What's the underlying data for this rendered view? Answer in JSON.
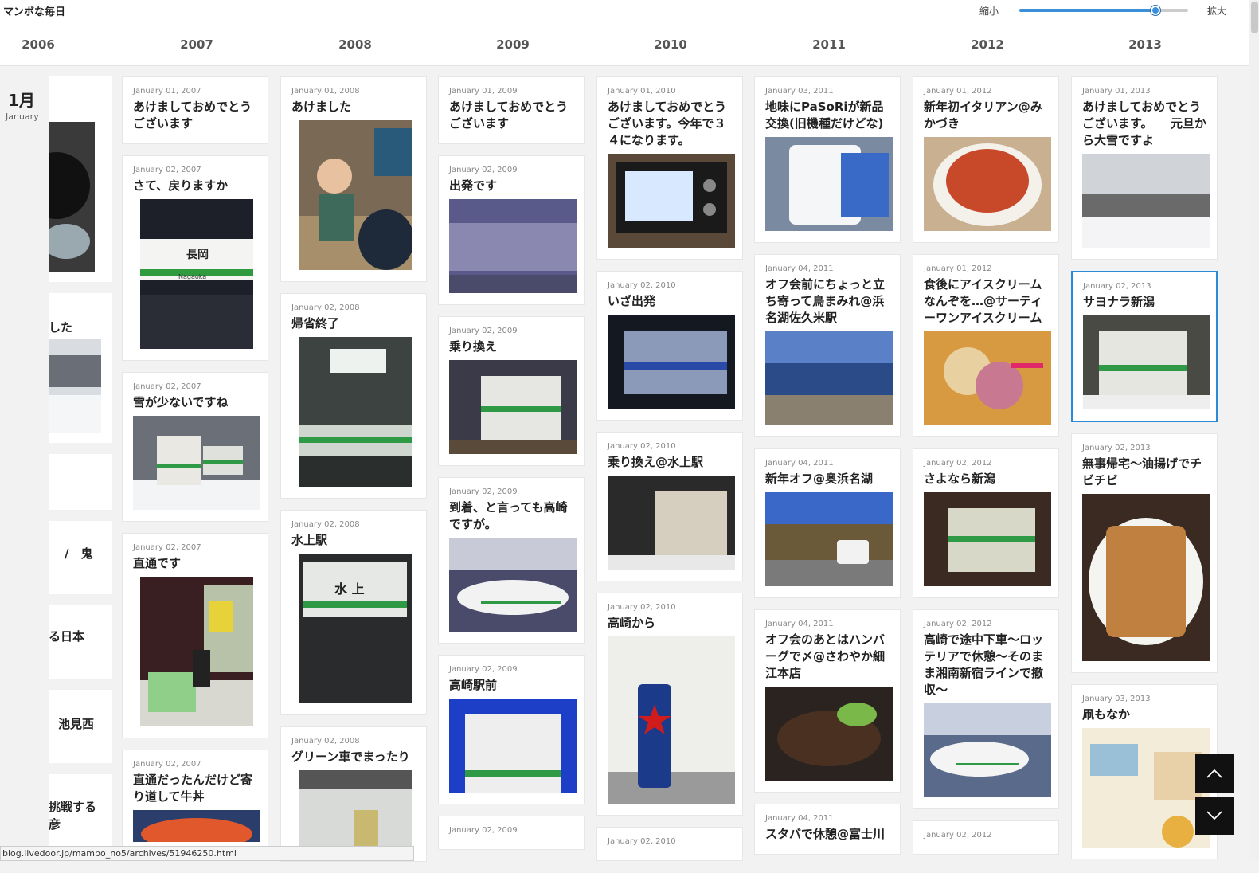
{
  "header": {
    "site_title": "マンボな毎日",
    "zoom_out_label": "縮小",
    "zoom_in_label": "拡大",
    "zoom_level": 0.8
  },
  "years": [
    "2006",
    "2007",
    "2008",
    "2009",
    "2010",
    "2011",
    "2012",
    "2013"
  ],
  "month": {
    "label": "1月",
    "sub": "January"
  },
  "left_fragments": [
    "した",
    "/　鬼",
    "る日本",
    "池見西",
    "挑戦する",
    "彦"
  ],
  "columns": [
    {
      "year": "2007",
      "cards": [
        {
          "date": "January 01, 2007",
          "title": "あけましておめでとうございます"
        },
        {
          "date": "January 02, 2007",
          "title": "さて、戻りますか"
        },
        {
          "date": "January 02, 2007",
          "title": "雪が少ないですね"
        },
        {
          "date": "January 02, 2007",
          "title": "直通です"
        },
        {
          "date": "January 02, 2007",
          "title": "直通だったんだけど寄り道して牛丼"
        }
      ]
    },
    {
      "year": "2008",
      "cards": [
        {
          "date": "January 01, 2008",
          "title": "あけました"
        },
        {
          "date": "January 02, 2008",
          "title": "帰省終了"
        },
        {
          "date": "January 02, 2008",
          "title": "水上駅"
        },
        {
          "date": "January 02, 2008",
          "title": "グリーン車でまったり"
        }
      ]
    },
    {
      "year": "2009",
      "cards": [
        {
          "date": "January 01, 2009",
          "title": "あけましておめでとうございます"
        },
        {
          "date": "January 02, 2009",
          "title": "出発です"
        },
        {
          "date": "January 02, 2009",
          "title": "乗り換え"
        },
        {
          "date": "January 02, 2009",
          "title": "到着、と言っても高崎ですが。"
        },
        {
          "date": "January 02, 2009",
          "title": "高崎駅前"
        },
        {
          "date": "January 02, 2009",
          "title": ""
        }
      ]
    },
    {
      "year": "2010",
      "cards": [
        {
          "date": "January 01, 2010",
          "title": "あけましておめでとうございます。今年で３４になります。"
        },
        {
          "date": "January 02, 2010",
          "title": "いざ出発"
        },
        {
          "date": "January 02, 2010",
          "title": "乗り換え@水上駅"
        },
        {
          "date": "January 02, 2010",
          "title": "高崎から"
        },
        {
          "date": "January 02, 2010",
          "title": ""
        }
      ]
    },
    {
      "year": "2011",
      "cards": [
        {
          "date": "January 03, 2011",
          "title": "地味にPaSoRiが新品交換(旧機種だけどな)"
        },
        {
          "date": "January 04, 2011",
          "title": "オフ会前にちょっと立ち寄って鳥まみれ@浜名湖佐久米駅"
        },
        {
          "date": "January 04, 2011",
          "title": "新年オフ@奥浜名湖"
        },
        {
          "date": "January 04, 2011",
          "title": "オフ会のあとはハンバーグで〆@さわやか細江本店"
        },
        {
          "date": "January 04, 2011",
          "title": "スタバで休憩@富士川"
        }
      ]
    },
    {
      "year": "2012",
      "cards": [
        {
          "date": "January 01, 2012",
          "title": "新年初イタリアン@みかづき"
        },
        {
          "date": "January 01, 2012",
          "title": "食後にアイスクリームなんぞを…@サーティーワンアイスクリーム"
        },
        {
          "date": "January 02, 2012",
          "title": "さよなら新潟"
        },
        {
          "date": "January 02, 2012",
          "title": "高崎で途中下車〜ロッテリアで休憩〜そのまま湘南新宿ラインで撤収〜"
        },
        {
          "date": "January 02, 2012",
          "title": ""
        }
      ]
    },
    {
      "year": "2013",
      "cards": [
        {
          "date": "January 01, 2013",
          "title": "あけましておめでとうございます。　　元旦から大雪ですよ"
        },
        {
          "date": "January 02, 2013",
          "title": "サヨナラ新潟"
        },
        {
          "date": "January 02, 2013",
          "title": "無事帰宅〜油揚げでチビチビ"
        },
        {
          "date": "January 03, 2013",
          "title": "凧もなか"
        }
      ]
    }
  ],
  "status_url": "blog.livedoor.jp/mambo_no5/archives/51946250.html",
  "icons": {
    "up": "chevron-up-icon",
    "down": "chevron-down-icon"
  },
  "colors": {
    "accent": "#2a8ad8",
    "nav_bg": "#111111"
  }
}
